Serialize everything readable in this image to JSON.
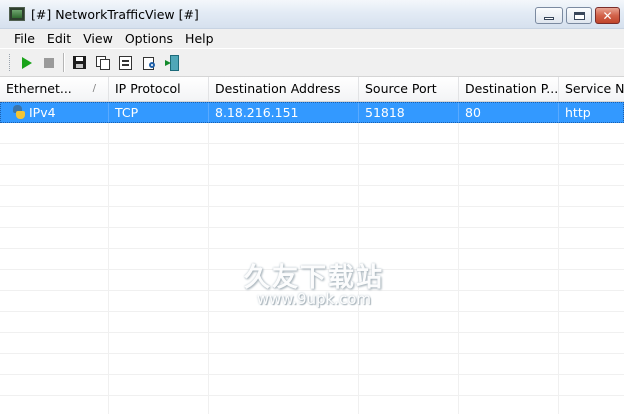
{
  "window": {
    "title": "[#] NetworkTrafficView [#]",
    "min_label": "",
    "max_label": "",
    "close_label": "✕"
  },
  "menu": {
    "items": [
      "File",
      "Edit",
      "View",
      "Options",
      "Help"
    ]
  },
  "toolbar": {
    "buttons": [
      {
        "name": "start-capture-button",
        "icon": "play-icon"
      },
      {
        "name": "stop-capture-button",
        "icon": "stop-icon"
      },
      {
        "name": "save-selected-button",
        "icon": "save-icon"
      },
      {
        "name": "copy-selected-button",
        "icon": "copy-icon"
      },
      {
        "name": "properties-button",
        "icon": "properties-icon"
      },
      {
        "name": "find-button",
        "icon": "find-icon"
      },
      {
        "name": "exit-button",
        "icon": "exit-icon"
      }
    ]
  },
  "table": {
    "columns": [
      {
        "label": "Ethernet...",
        "sort": "/"
      },
      {
        "label": "IP Protocol"
      },
      {
        "label": "Destination Address"
      },
      {
        "label": "Source Port"
      },
      {
        "label": "Destination P..."
      },
      {
        "label": "Service Na"
      }
    ],
    "rows": [
      {
        "cells": [
          "IPv4",
          "TCP",
          "8.18.216.151",
          "51818",
          "80",
          "http"
        ],
        "icon": "python-icon",
        "selected": true
      }
    ]
  },
  "watermark": {
    "text": "久友下载站",
    "url": "www.9upk.com"
  },
  "colors": {
    "selection": "#3399ff",
    "play": "#1aa31a"
  }
}
